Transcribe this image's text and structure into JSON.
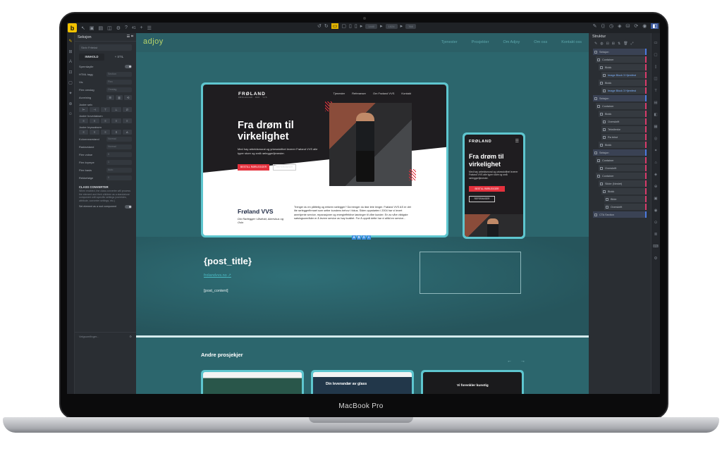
{
  "device": {
    "label": "MacBook Pro"
  },
  "toolbar": {
    "logo": "b",
    "zoom": "41",
    "left_icons": [
      "cursor-icon",
      "add-element-icon",
      "pages-icon",
      "templates-icon",
      "settings-icon",
      "help-icon"
    ],
    "breakpoint_chips": [
      "1440",
      "1024",
      "768"
    ]
  },
  "left_panel": {
    "title": "Seksjon",
    "search_placeholder": "Skriv Fritekst",
    "tabs": {
      "content": "INNHOLD",
      "style": "+ STIL"
    },
    "hide_label": "Sperrdøylle",
    "rows": [
      {
        "label": "HTML tagg",
        "value": "Section"
      },
      {
        "label": "Vis",
        "value": "Flex"
      },
      {
        "label": "Flex omslag",
        "value": "Omslag"
      },
      {
        "label": "Avveining",
        "value": ""
      }
    ],
    "justify_label": "Juster selv",
    "justify_main_label": "Juster hovedaksen",
    "align_label": "Juster kryssaksen",
    "spacing_rows": [
      {
        "label": "Kolonneavstand",
        "value": "Normal"
      },
      {
        "label": "Radavstand",
        "value": "Normal"
      },
      {
        "label": "Flex vokse",
        "value": "0"
      },
      {
        "label": "Flex krympe",
        "value": "1"
      },
      {
        "label": "Flex basis",
        "value": "Auto"
      },
      {
        "label": "Rekkefølge",
        "value": "0"
      }
    ],
    "class_converter": {
      "title": "CLASS CONVERTER",
      "description": "When enabled, the class converter will process the element and their children as a standalone component with specific settings (overrides, attribute, converter settings, etc.)",
      "toggle_label": "Set element as a root component"
    },
    "footer_placeholder": "Velgsomfinger..."
  },
  "site": {
    "logo": "adjoy",
    "nav": [
      "Tjenester",
      "Prosjekter",
      "Om Adjoy",
      "Om oss",
      "Kontakt oss"
    ],
    "post_title": "{post_title}",
    "post_link": "frolandvvs.no",
    "post_content": "[post_content]",
    "more_heading": "Andre prosjekjer",
    "arrows": "← →"
  },
  "desktop_mockup": {
    "logo": "FRØLAND",
    "logo_sub": "RØRLEGGER · BAD · VVS",
    "nav": [
      "Tjenester",
      "Referanser",
      "Om Frøland VVS",
      "Kontakt"
    ],
    "headline": "Fra drøm til virkelighet",
    "intro": "Med hay arbeidsmoral og yrkesstolthet leverer Frøland VVS alle typer store og små rørleggerfjenester.",
    "cta_primary": "BESTILL RØRLEGGER",
    "cta_secondary": "REFERANSER",
    "company": "Frøland VVS",
    "company_sub": "Din Rørlegger i Østfold, Akershus og Oslo",
    "body": "Trenger du en pålitelig og erfaren rørlegger? Da trenger du ikke lete lenger. Frøland VVS AS er det lite rørleggerfirmaet som setter kundens behov i fokus. Siden oppstarten i 2004 har vi levert anerkjente service, reparasjoner og energieffektive løsninger til våre kunder. En av våre viktigste satsingsområder er å levere service av høy kvalitet. For å oppnå dette har vi alltid en service..."
  },
  "mobile_mockup": {
    "logo": "FRØLAND",
    "headline": "Fra drøm til virkelighet",
    "intro": "Med hay arbeidsmoral og yrkesstolthet leverer Frøland VVS alle typer store og små rørleggerfjenester.",
    "cta_primary": "BESTILL RØRLEGGER",
    "cta_secondary": "REFERANSER"
  },
  "cards": [
    {
      "title": ""
    },
    {
      "title": "Din leverandør av glass"
    },
    {
      "title": "Vi forenkler kunstig"
    }
  ],
  "right_panel": {
    "title": "Struktur",
    "tree": [
      {
        "label": "Seksjon",
        "kind": "sec",
        "depth": 0
      },
      {
        "label": "Container",
        "kind": "el",
        "depth": 1
      },
      {
        "label": "Blokk",
        "kind": "el",
        "depth": 2
      },
      {
        "label": "Image Block 3 Hjemfest",
        "kind": "cls",
        "depth": 3
      },
      {
        "label": "Blokk",
        "kind": "el",
        "depth": 2
      },
      {
        "label": "Image Block 3 Hjemfest",
        "kind": "cls",
        "depth": 3
      },
      {
        "label": "Seksjon",
        "kind": "sec",
        "depth": 0
      },
      {
        "label": "Container",
        "kind": "el",
        "depth": 1
      },
      {
        "label": "Blokk",
        "kind": "el",
        "depth": 2
      },
      {
        "label": "Overskrift",
        "kind": "el",
        "depth": 3
      },
      {
        "label": "Tekstlenke",
        "kind": "el",
        "depth": 3
      },
      {
        "label": "Ra tekst",
        "kind": "el",
        "depth": 3
      },
      {
        "label": "Blokk",
        "kind": "el",
        "depth": 2
      },
      {
        "label": "Seksjon",
        "kind": "sec",
        "depth": 0
      },
      {
        "label": "Container",
        "kind": "el",
        "depth": 1
      },
      {
        "label": "Overskrift",
        "kind": "el",
        "depth": 2
      },
      {
        "label": "Container",
        "kind": "el",
        "depth": 1
      },
      {
        "label": "Slider (Nestet)",
        "kind": "el",
        "depth": 2
      },
      {
        "label": "Blokk",
        "kind": "el",
        "depth": 3
      },
      {
        "label": "Bilde",
        "kind": "el",
        "depth": 4
      },
      {
        "label": "Overskrift",
        "kind": "el",
        "depth": 4
      },
      {
        "label": "CTA Section",
        "kind": "sec",
        "depth": 0
      }
    ]
  }
}
